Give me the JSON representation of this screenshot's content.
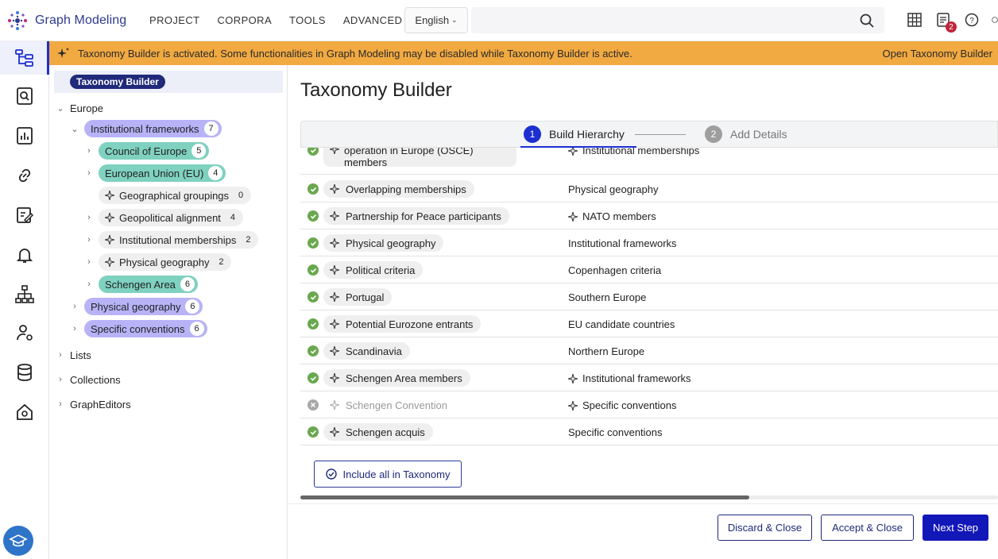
{
  "app": {
    "title": "Graph Modeling"
  },
  "menu": [
    "PROJECT",
    "CORPORA",
    "TOOLS",
    "ADVANCED"
  ],
  "language": {
    "selected": "English"
  },
  "notifications": {
    "count": "2"
  },
  "banner": {
    "message": "Taxonomy Builder is activated. Some functionalities in Graph Modeling may be disabled while Taxonomy Builder is active.",
    "link": "Open Taxonomy Builder",
    "color": "#f1a941"
  },
  "tree": {
    "header_pill": "Taxonomy Builder",
    "root": "Europe",
    "nodes": [
      {
        "label": "Institutional frameworks",
        "count": "7"
      },
      {
        "label": "Council of Europe",
        "count": "5"
      },
      {
        "label": "European Union (EU)",
        "count": "4"
      },
      {
        "label": "Geographical groupings",
        "count": "0"
      },
      {
        "label": "Geopolitical alignment",
        "count": "4"
      },
      {
        "label": "Institutional memberships",
        "count": "2"
      },
      {
        "label": "Physical geography",
        "count": "2"
      },
      {
        "label": "Schengen Area",
        "count": "6"
      },
      {
        "label": "Physical geography",
        "count": "6"
      },
      {
        "label": "Specific conventions",
        "count": "6"
      }
    ],
    "others": [
      "Lists",
      "Collections",
      "GraphEditors"
    ]
  },
  "main": {
    "title": "Taxonomy Builder",
    "steps": [
      {
        "num": "1",
        "label": "Build Hierarchy"
      },
      {
        "num": "2",
        "label": "Add Details"
      }
    ],
    "rows": [
      {
        "name_line1": "operation in Europe (OSCE)",
        "name_line2": "members",
        "parent": "Institutional memberships",
        "status": "accepted"
      },
      {
        "name": "Overlapping memberships",
        "parent": "Physical geography",
        "status": "accepted"
      },
      {
        "name": "Partnership for Peace participants",
        "parent": "NATO members",
        "status": "accepted"
      },
      {
        "name": "Physical geography",
        "parent": "Institutional frameworks",
        "status": "accepted"
      },
      {
        "name": "Political criteria",
        "parent": "Copenhagen criteria",
        "status": "accepted"
      },
      {
        "name": "Portugal",
        "parent": "Southern Europe",
        "status": "accepted"
      },
      {
        "name": "Potential Eurozone entrants",
        "parent": "EU candidate countries",
        "status": "accepted"
      },
      {
        "name": "Scandinavia",
        "parent": "Northern Europe",
        "status": "accepted"
      },
      {
        "name": "Schengen Area members",
        "parent": "Institutional frameworks",
        "status": "accepted"
      },
      {
        "name": "Schengen Convention",
        "parent": "Specific conventions",
        "status": "rejected"
      },
      {
        "name": "Schengen acquis",
        "parent": "Specific conventions",
        "status": "accepted"
      }
    ],
    "include_all_label": "Include all in Taxonomy",
    "buttons": {
      "discard": "Discard & Close",
      "accept": "Accept & Close",
      "next": "Next Step"
    }
  }
}
